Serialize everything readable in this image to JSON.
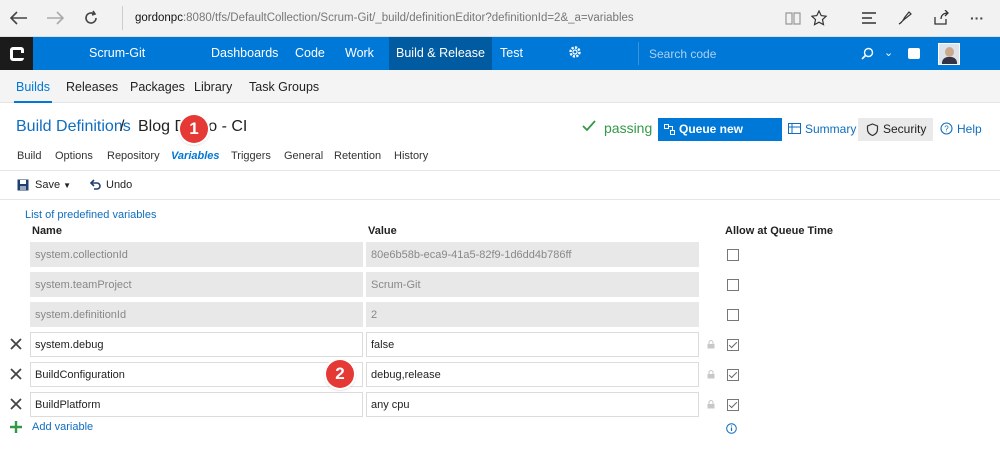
{
  "browser": {
    "url_host": "gordonpc",
    "url_rest": ":8080/tfs/DefaultCollection/Scrum-Git/_build/definitionEditor?definitionId=2&_a=variables",
    "icons": [
      "back-icon",
      "forward-icon",
      "refresh-icon",
      "reading-view-icon",
      "favorite-star-icon",
      "hub-icon",
      "notes-icon",
      "share-icon",
      "more-icon"
    ],
    "more_label": "···"
  },
  "topnav": {
    "project": "Scrum-Git",
    "items": [
      "Dashboards",
      "Code",
      "Work",
      "Build & Release",
      "Test"
    ],
    "active": "Build & Release",
    "search_placeholder": "Search code"
  },
  "hubs": {
    "items": [
      "Builds",
      "Releases",
      "Packages",
      "Library",
      "Task Groups"
    ],
    "active": "Builds"
  },
  "title": {
    "breadcrumb": "Build Definitions",
    "separator": "/",
    "definition_name": "Blog Demo - CI",
    "status": "passing",
    "queue_button": "Queue new build...",
    "summary": "Summary",
    "security": "Security",
    "help": "Help"
  },
  "tabs": {
    "items": [
      "Build",
      "Options",
      "Repository",
      "Variables",
      "Triggers",
      "General",
      "Retention",
      "History"
    ],
    "active": "Variables"
  },
  "toolbar": {
    "save": "Save",
    "undo": "Undo"
  },
  "variables": {
    "predefined_link": "List of predefined variables",
    "headers": {
      "name": "Name",
      "value": "Value",
      "queue": "Allow at Queue Time"
    },
    "rows": [
      {
        "name": "system.collectionId",
        "value": "80e6b58b-eca9-41a5-82f9-1d6dd4b786ff",
        "readonly": true,
        "allow": false
      },
      {
        "name": "system.teamProject",
        "value": "Scrum-Git",
        "readonly": true,
        "allow": false
      },
      {
        "name": "system.definitionId",
        "value": "2",
        "readonly": true,
        "allow": false
      },
      {
        "name": "system.debug",
        "value": "false",
        "readonly": false,
        "allow": true
      },
      {
        "name": "BuildConfiguration",
        "value": "debug,release",
        "readonly": false,
        "allow": true
      },
      {
        "name": "BuildPlatform",
        "value": "any cpu",
        "readonly": false,
        "allow": true
      }
    ],
    "add_label": "Add variable"
  },
  "callouts": [
    "1",
    "2"
  ],
  "colors": {
    "accent": "#0078d7",
    "success": "#339947",
    "callout": "#e53935"
  }
}
